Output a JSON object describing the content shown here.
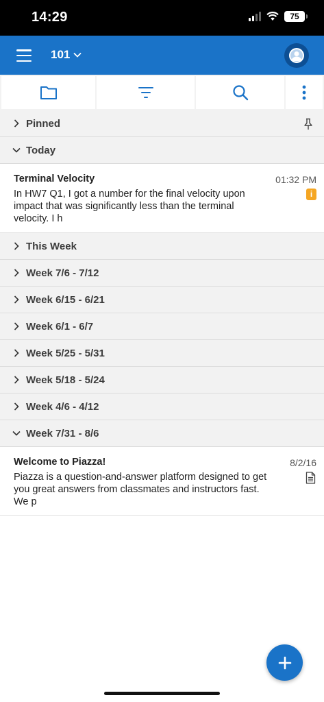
{
  "status_bar": {
    "time": "14:29",
    "battery": "75"
  },
  "app_bar": {
    "course": "101"
  },
  "toolbar": {
    "icons": [
      "folder-icon",
      "filter-icon",
      "search-icon",
      "more-vert-icon"
    ]
  },
  "sections": {
    "pinned": "Pinned",
    "today": "Today",
    "this_week": "This Week",
    "week_7_6": "Week 7/6 - 7/12",
    "week_6_15": "Week 6/15 - 6/21",
    "week_6_1": "Week 6/1 - 6/7",
    "week_5_25": "Week 5/25 - 5/31",
    "week_5_18": "Week 5/18 - 5/24",
    "week_4_6": "Week 4/6 - 4/12",
    "week_7_31": "Week 7/31 - 8/6"
  },
  "posts": [
    {
      "title": "Terminal Velocity",
      "body": "In HW7 Q1, I got a number for the final velocity upon impact that was significantly less than the terminal velocity. I h",
      "date": "01:32 PM",
      "badge": "i"
    },
    {
      "title": "Welcome to Piazza!",
      "body": "Piazza is a question-and-answer platform designed to get you great answers from classmates and instructors fast. We p",
      "date": "8/2/16"
    }
  ],
  "colors": {
    "brand": "#1a73c8",
    "badge": "#f5a623",
    "section_bg": "#f2f2f2"
  }
}
